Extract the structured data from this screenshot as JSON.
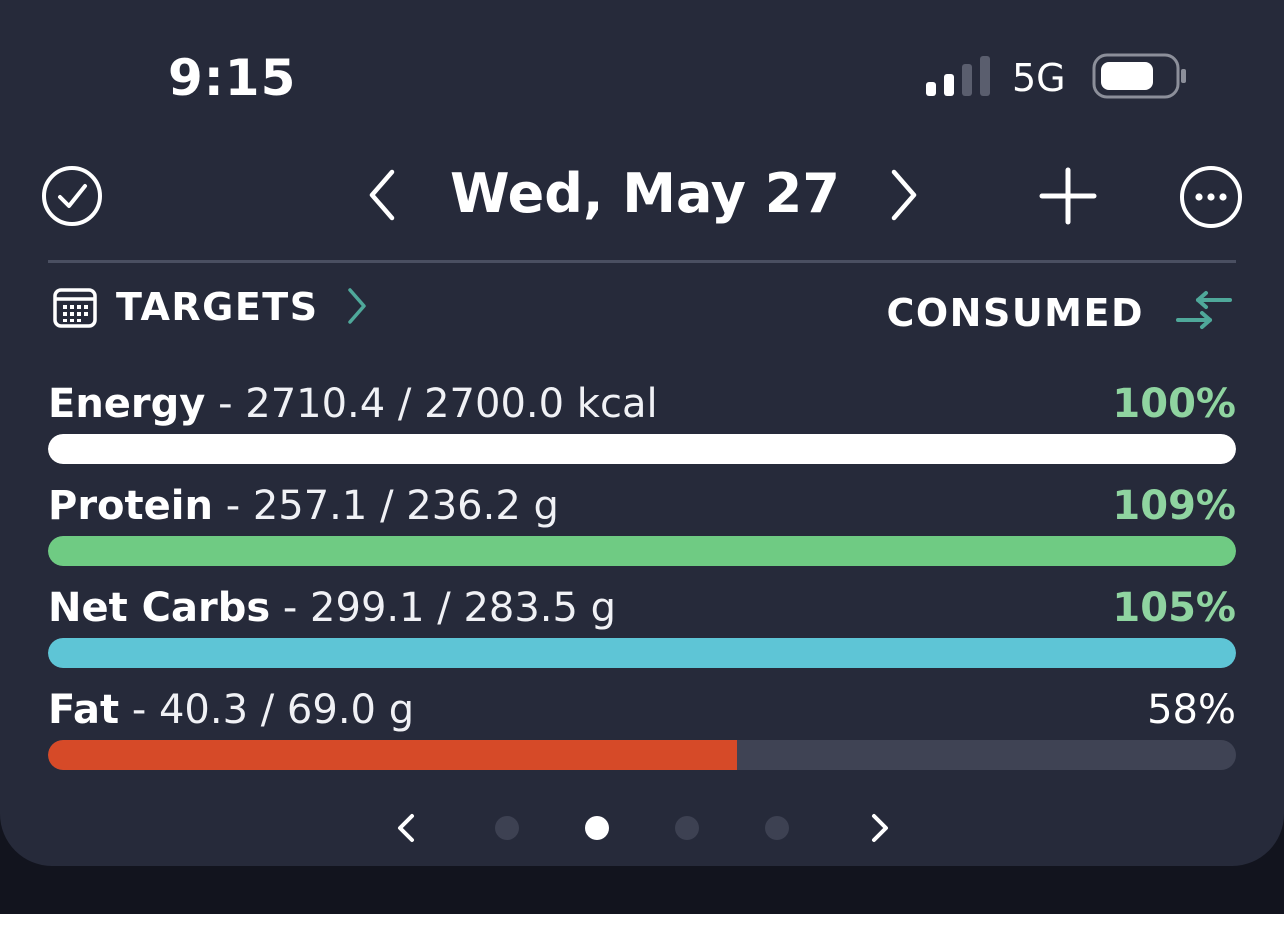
{
  "status_bar": {
    "time": "9:15",
    "network": "5G"
  },
  "header": {
    "date": "Wed, May 27"
  },
  "targets": {
    "label": "TARGETS",
    "mode_label": "CONSUMED"
  },
  "nutrients": [
    {
      "name": "Energy",
      "values": "- 2710.4 / 2700.0 kcal",
      "percent_label": "100%",
      "fill_fraction": 1.0,
      "bar_color": "#ffffff",
      "pct_color": "#8fd4a0"
    },
    {
      "name": "Protein",
      "values": "- 257.1 / 236.2 g",
      "percent_label": "109%",
      "fill_fraction": 1.0,
      "bar_color": "#6fcb83",
      "pct_color": "#8fd4a0"
    },
    {
      "name": "Net Carbs",
      "values": "- 299.1 / 283.5 g",
      "percent_label": "105%",
      "fill_fraction": 1.0,
      "bar_color": "#5ec5d6",
      "pct_color": "#8fd4a0"
    },
    {
      "name": "Fat",
      "values": "- 40.3 / 69.0 g",
      "percent_label": "58%",
      "fill_fraction": 0.58,
      "bar_color": "#d64a28",
      "pct_color": "#ffffff"
    }
  ],
  "pager": {
    "page_count": 4,
    "active_page": 2
  },
  "colors": {
    "background": "#262a3a",
    "accent_teal": "#4fa89a",
    "good_green": "#8fd4a0"
  },
  "icons": [
    "check-circle-icon",
    "chevron-left-icon",
    "chevron-right-icon",
    "plus-icon",
    "more-icon",
    "calendar-icon",
    "swap-arrows-icon",
    "signal-icon",
    "battery-icon"
  ]
}
